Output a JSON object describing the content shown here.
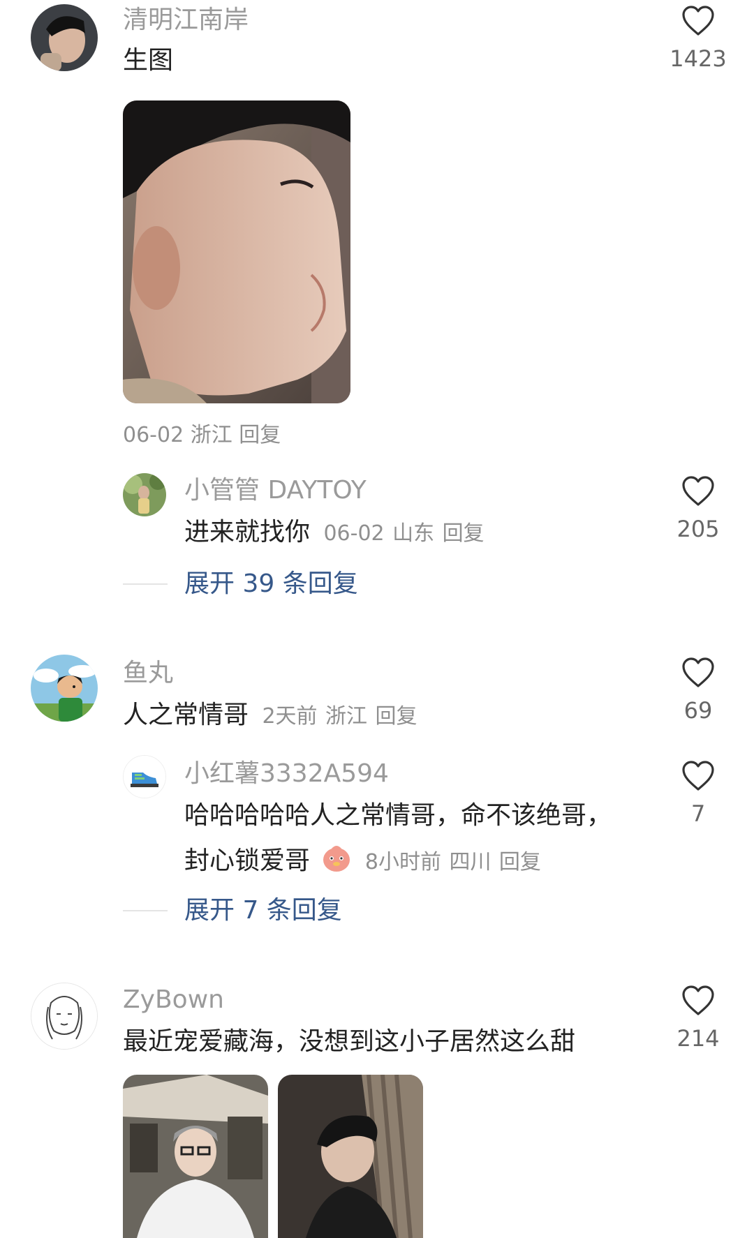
{
  "comments": [
    {
      "username": "清明江南岸",
      "text": "生图",
      "likes": "1423",
      "date": "06-02",
      "location": "浙江",
      "reply_label": "回复",
      "sub_reply": {
        "username": "小管管 DAYTOY",
        "text": "进来就找你",
        "date": "06-02",
        "location": "山东",
        "reply_label": "回复",
        "likes": "205"
      },
      "expand_label": "展开 39 条回复"
    },
    {
      "username": "鱼丸",
      "text": "人之常情哥",
      "date": "2天前",
      "location": "浙江",
      "reply_label": "回复",
      "likes": "69",
      "sub_reply": {
        "username": "小红薯3332A594",
        "text_line1": "哈哈哈哈哈人之常情哥，命不该绝哥，",
        "text_line2": "封心锁爱哥",
        "date": "8小时前",
        "location": "四川",
        "reply_label": "回复",
        "likes": "7"
      },
      "expand_label": "展开 7 条回复"
    },
    {
      "username": "ZyBown",
      "text": "最近宠爱藏海，没想到这小子居然这么甜",
      "likes": "214"
    }
  ],
  "icons": {
    "like": "heart-outline-icon",
    "emoji": "cute-chick-emoji-icon",
    "sub_avatar": "sneaker-icon"
  },
  "colors": {
    "username": "#9a9a9a",
    "text": "#222222",
    "meta": "#8f8f8f",
    "expand": "#36588a",
    "heart_stroke": "#333333"
  }
}
